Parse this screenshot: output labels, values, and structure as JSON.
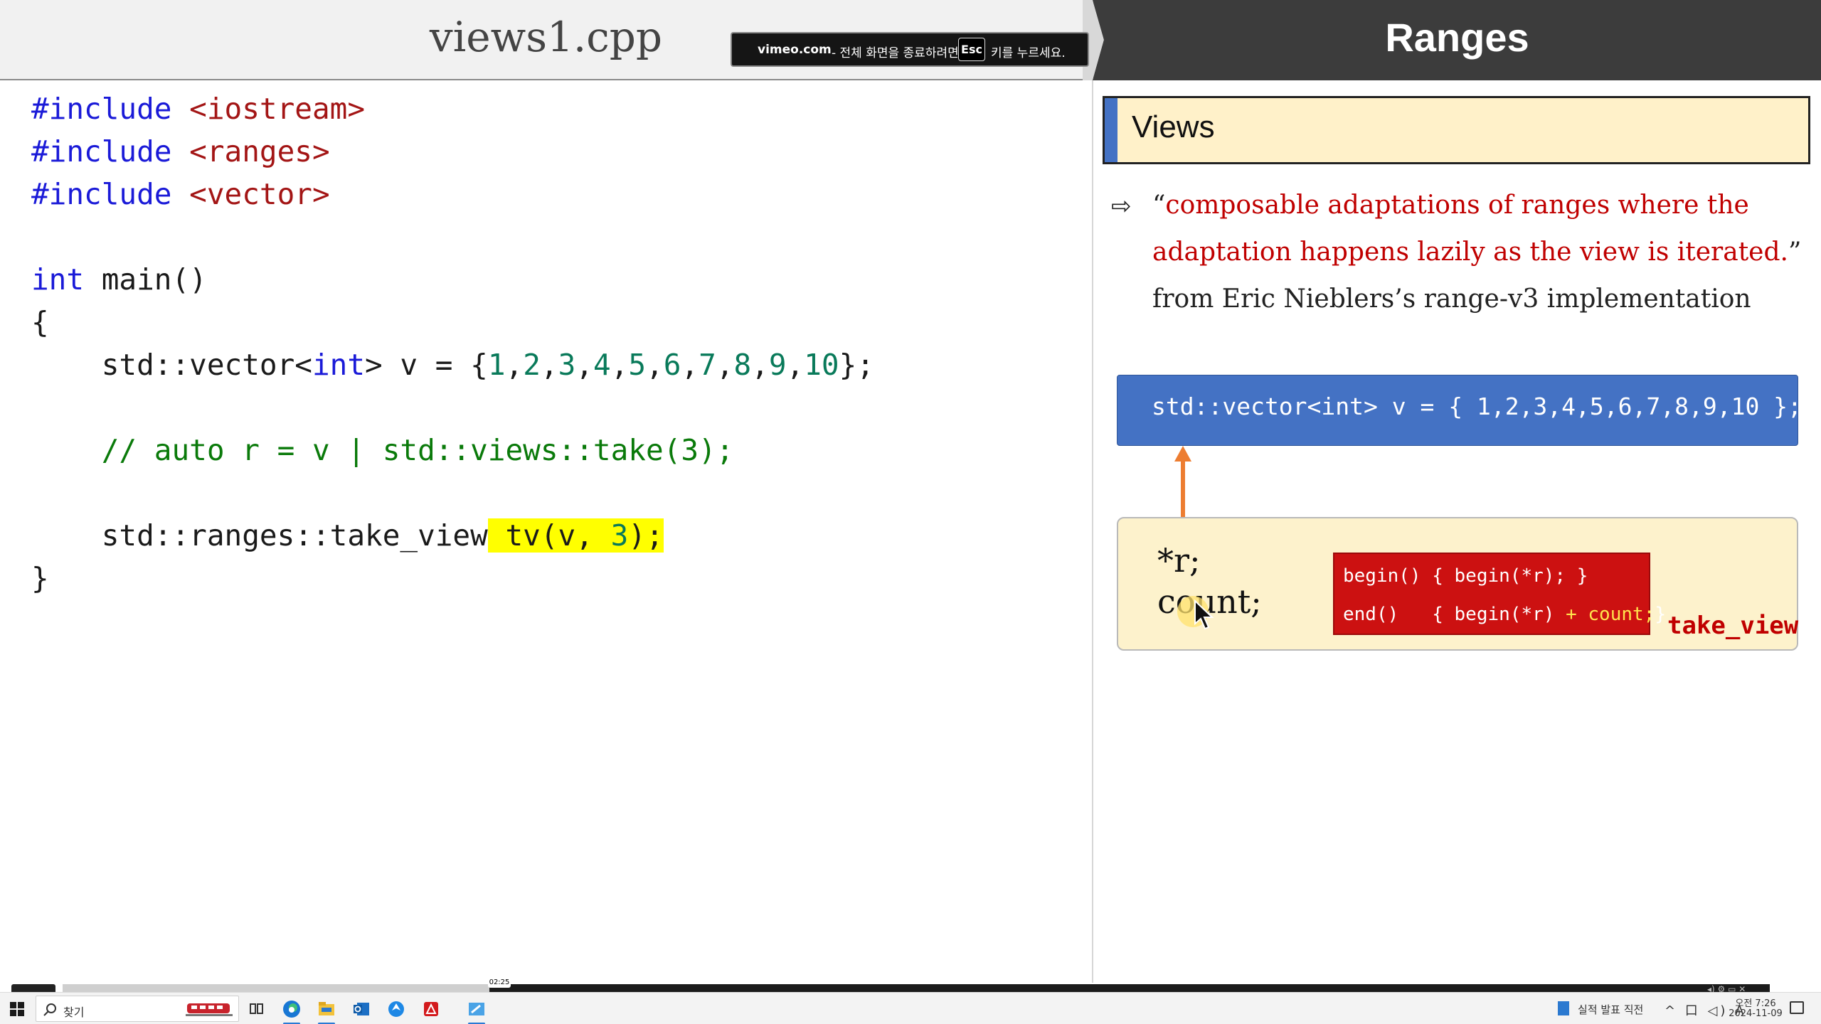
{
  "editor": {
    "file_title": "views1.cpp",
    "code": {
      "l1_kw": "#include",
      "l1_hdr": "<iostream>",
      "l2_kw": "#include",
      "l2_hdr": "<ranges>",
      "l3_kw": "#include",
      "l3_hdr": "<vector>",
      "l5_type": "int",
      "l5_rest": "main()",
      "l6": "{",
      "l7_a": "std::vector<",
      "l7_type": "int",
      "l7_b": "> v = {",
      "l7_nums": [
        "1",
        "2",
        "3",
        "4",
        "5",
        "6",
        "7",
        "8",
        "9",
        "10"
      ],
      "l7_end": "};",
      "l9_comment": "// auto r = v | std::views::take(3);",
      "l11_a": "std::ranges::take_view",
      "l11_hl1": " tv(v, ",
      "l11_num": "3",
      "l11_hl2": ");",
      "l12": "}"
    }
  },
  "slide": {
    "title": "Ranges",
    "views_heading": "Views",
    "quote_open": "“",
    "quote_line1": "composable adaptations of ranges where the",
    "quote_line2": "adaptation happens lazily as the view is iterated.",
    "quote_close": "”",
    "attribution": "from Eric Nieblers’s range-v3 implementation",
    "vector_code": "std::vector<int> v = { 1,2,3,4,5,6,7,8,9,10 };",
    "member_r": "*r;",
    "member_count": "count;",
    "begin_line": "begin() { begin(*r); }",
    "end_line_a": "end()   { begin(*r) ",
    "end_line_b": "+ count;",
    "end_line_c": "}",
    "take_view_label": "take_view",
    "colors": {
      "header_bg": "#3c3c3c",
      "views_box": "#fff1c9",
      "accent_blue": "#4472c4",
      "quote_red": "#c00000",
      "arrow_orange": "#ed7d31",
      "red_box": "#cc1111"
    }
  },
  "vimeo_notice": {
    "domain": "vimeo.com",
    "message": "- 전체 화면을 종료하려면",
    "key": "Esc",
    "message2": "키를 누르세요."
  },
  "player": {
    "time": "02:25",
    "progress": 0.25
  },
  "taskbar": {
    "search_placeholder": "찾기",
    "apps": [
      "task-view-icon",
      "edge-icon",
      "file-explorer-icon",
      "outlook-icon",
      "app-icon",
      "acrobat-icon",
      "paint-icon"
    ],
    "tray_doc_label": "실적 발표 직전",
    "tray_icons": "^ 口 ◁) A",
    "clock_time": "오전 7:26",
    "clock_date": "2024-11-09"
  }
}
